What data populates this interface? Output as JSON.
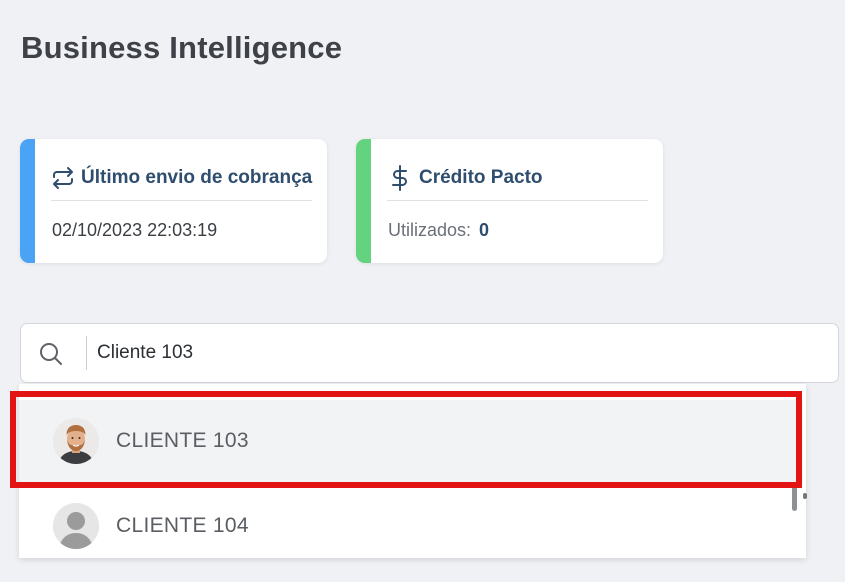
{
  "page": {
    "title": "Business Intelligence"
  },
  "cards": {
    "billing": {
      "icon": "sync-arrows-icon",
      "title": "Último envio de cobrança",
      "value": "02/10/2023 22:03:19",
      "accent": "#4aa3f5"
    },
    "credit": {
      "icon": "dollar-icon",
      "title": "Crédito Pacto",
      "label": "Utilizados:",
      "value": "0",
      "accent": "#63d37f"
    }
  },
  "search": {
    "icon": "search-icon",
    "value": "Cliente 103"
  },
  "results": [
    {
      "name": "CLIENTE 103",
      "avatar": "avatar-photo",
      "hovered": true
    },
    {
      "name": "CLIENTE 104",
      "avatar": "avatar-placeholder",
      "hovered": false
    }
  ],
  "highlight": {
    "color": "#e31414"
  }
}
